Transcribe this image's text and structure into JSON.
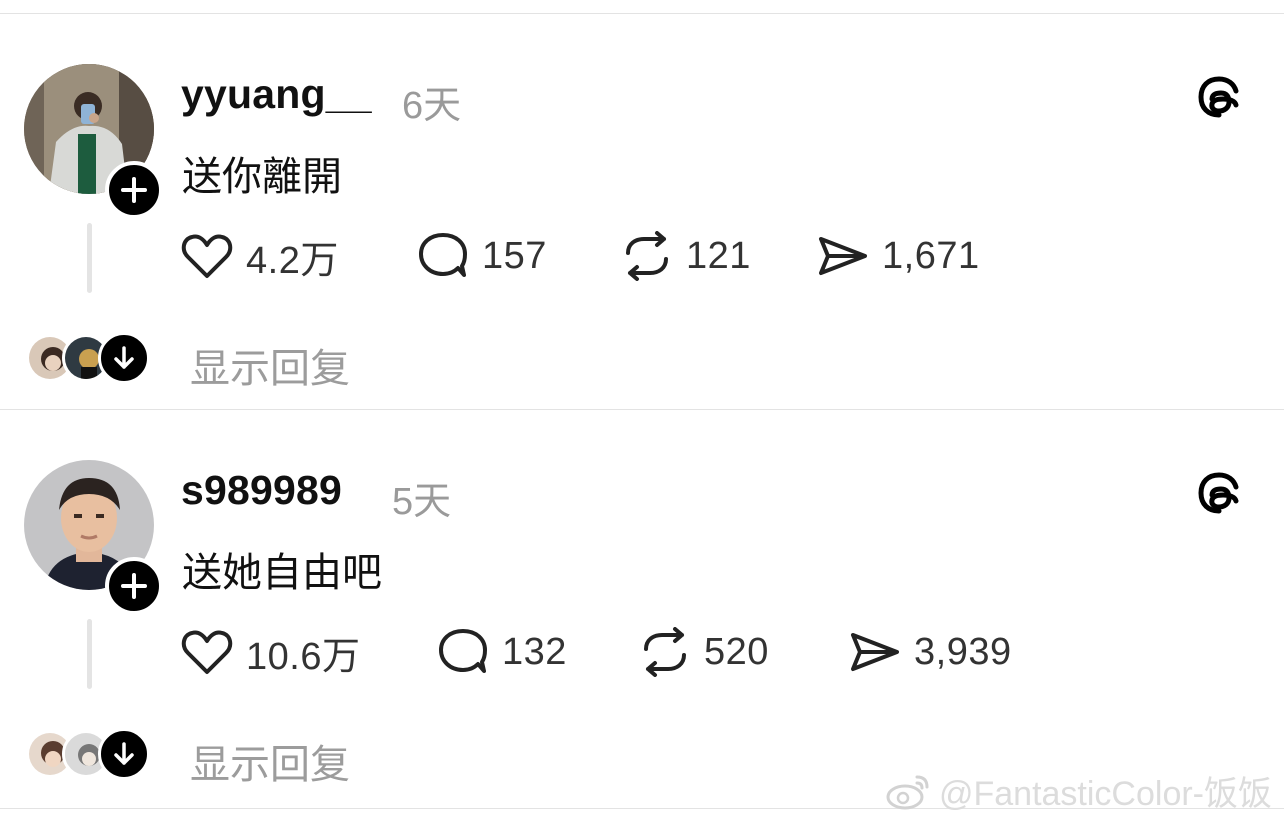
{
  "posts": [
    {
      "username": "yyuang__",
      "time": "6天",
      "text": "送你離開",
      "likes": "4.2万",
      "comments": "157",
      "reposts": "121",
      "shares": "1,671",
      "show_replies": "显示回复"
    },
    {
      "username": "s989989",
      "time": "5天",
      "text": "送她自由吧",
      "likes": "10.6万",
      "comments": "132",
      "reposts": "520",
      "shares": "3,939",
      "show_replies": "显示回复"
    }
  ],
  "icons": {
    "like": "heart-icon",
    "comment": "comment-icon",
    "repost": "repost-icon",
    "share": "send-icon",
    "brand": "threads-logo-icon",
    "follow": "plus-icon",
    "expand": "arrow-down-icon"
  },
  "watermark": {
    "text": "@FantasticColor-饭饭"
  },
  "colors": {
    "text": "#111111",
    "muted": "#9a9a9a",
    "divider": "#e3e3e3",
    "button": "#000000"
  }
}
